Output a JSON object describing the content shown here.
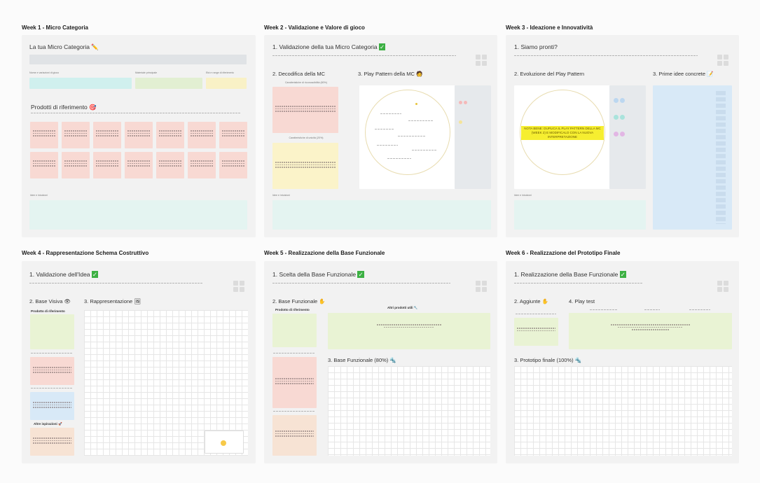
{
  "weeks": [
    {
      "title": "Week 1 - Micro Categoria"
    },
    {
      "title": "Week 2 - Validazione e Valore di gioco"
    },
    {
      "title": "Week 3 - Ideazione e Innovatività"
    },
    {
      "title": "Week 4 - Rappresentazione Schema Costruttivo"
    },
    {
      "title": "Week 5 - Realizzazione della Base Funzionale"
    },
    {
      "title": "Week 6 - Realizzazione del Prototipo Finale"
    }
  ],
  "w1": {
    "heading": "La tua Micro Categoria",
    "field1": "Nome e variazioni di gioco",
    "field2": "Materiale principale",
    "field3": "Età e range di riferimento",
    "products_heading": "Prodotti di riferimento",
    "ideas_label": "Idee e intuizioni"
  },
  "w2": {
    "heading": "1. Validazione della tua Micro Categoria",
    "sub1": "2. Decodifica della MC",
    "sub2": "3. Play Pattern della MC",
    "card1": "Caratteristiche di riconoscibilità (80%)",
    "card2": "Caratteristiche di unicità (20%)",
    "ideas_label": "Idee e intuizioni"
  },
  "w3": {
    "heading": "1. Siamo pronti?",
    "sub1": "2. Evoluzione del Play Pattern",
    "sub2": "3. Prime idee concrete",
    "highlight": "NOTA BENE: DUPLICA IL PLAY PATTERN DELLA MC (WEEK 2) E MODIFICALO CON LA NUOVA INTERPRETAZIONE",
    "ideas_label": "Idee e intuizioni"
  },
  "w4": {
    "heading": "1. Validazione dell'Idea",
    "sub1": "2. Base Visiva",
    "sub2": "3. Rappresentazione",
    "col1": "Prodotto di riferimento",
    "col2": "Altre ispirazioni"
  },
  "w5": {
    "heading": "1. Scelta della Base Funzionale",
    "sub1": "2. Base Funzionale",
    "sub2": "3. Base Funzionale (80%)",
    "ref": "Prodotto di riferimento",
    "others": "Altri prodotti utili"
  },
  "w6": {
    "heading": "1. Realizzazione della Base Funzionale",
    "sub1": "2. Aggiunte",
    "sub2": "4. Play test",
    "sub3": "3. Prototipo finale (100%)"
  },
  "colors": {
    "pink": "#f8d9d3",
    "yellow": "#fbf3c9",
    "mint": "#e4f4f1",
    "green": "#e9f3d4",
    "blue": "#d8e9f7",
    "peach": "#f7e3d4"
  }
}
